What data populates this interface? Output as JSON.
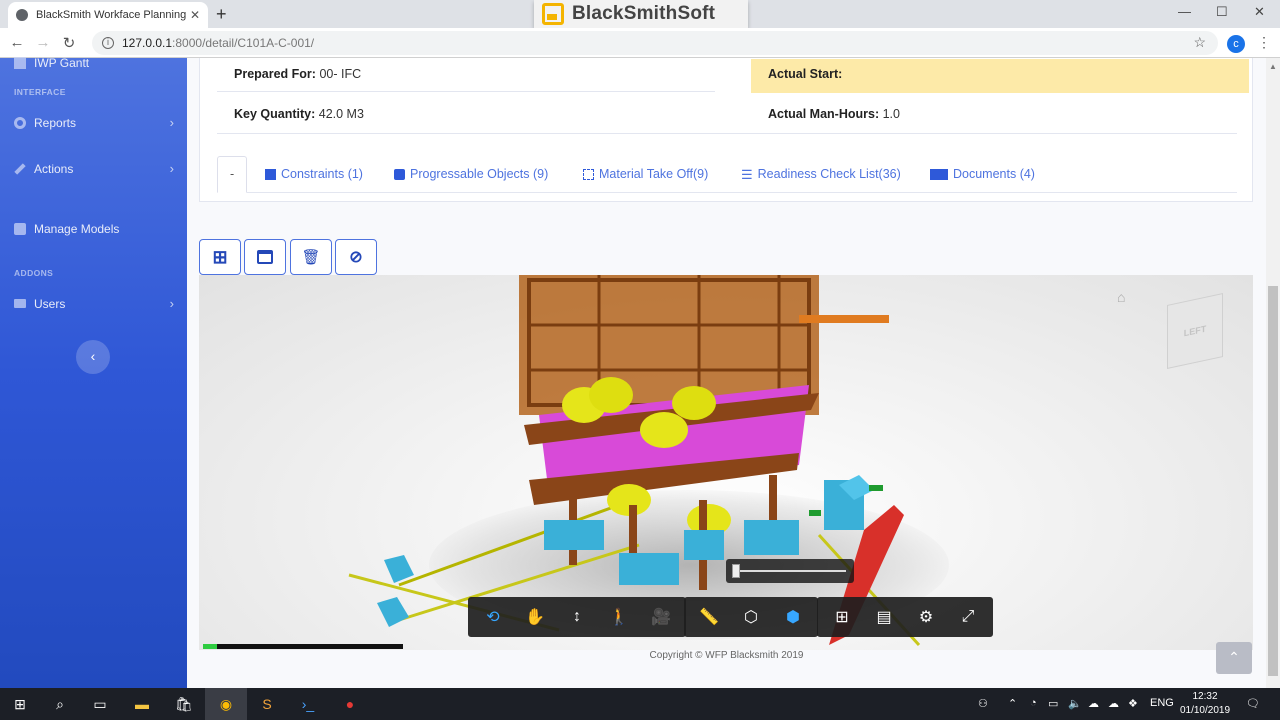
{
  "browser": {
    "tab_title": "BlackSmith Workface Planning",
    "tab_close": "✕",
    "new_tab": "+",
    "url_host": "127.0.0.1",
    "url_path": ":8000/detail/C101A-C-001/",
    "profile_initial": "c",
    "minimize": "—",
    "maximize": "☐",
    "close": "✕"
  },
  "brand": {
    "name": "BlackSmithSoft",
    "accent": "#f4b400"
  },
  "sidebar": {
    "partial_item": "IWP Gantt",
    "heading_interface": "INTERFACE",
    "heading_addons": "ADDONS",
    "items": [
      {
        "label": "Reports",
        "icon": "gear-icon"
      },
      {
        "label": "Actions",
        "icon": "wrench-icon"
      },
      {
        "label": "Manage Models",
        "icon": "cubes-icon"
      },
      {
        "label": "Users",
        "icon": "folder-icon"
      }
    ],
    "collapse_glyph": "‹",
    "gradient_top": "#4e73df",
    "gradient_bottom": "#224abe"
  },
  "details": {
    "prepared_for_label": "Prepared For:",
    "prepared_for_value": "00- IFC",
    "actual_start_label": "Actual Start:",
    "key_quantity_label": "Key Quantity:",
    "key_quantity_value": "42.0 M3",
    "actual_manhours_label": "Actual Man-Hours:",
    "actual_manhours_value": "1.0",
    "highlight_color": "#fdeaa8"
  },
  "tabs": [
    {
      "label": "-"
    },
    {
      "label": "Constraints (1)"
    },
    {
      "label": "Progressable Objects (9)"
    },
    {
      "label": "Material Take Off(9)"
    },
    {
      "label": "Readiness Check List(36)"
    },
    {
      "label": "Documents (4)"
    }
  ],
  "viewer": {
    "viewcube_label": "LEFT",
    "home_glyph": "⌂",
    "load_progress_percent": 7,
    "tools_nav": [
      "⟲",
      "✋",
      "↕",
      "🚶",
      "🎥"
    ],
    "tools_model": [
      "📏",
      "⬡",
      "⬢"
    ],
    "tools_settings": [
      "⊞",
      "▤",
      "⚙",
      "⤢"
    ]
  },
  "footer": {
    "copyright": "Copyright © WFP Blacksmith 2019",
    "to_top": "⌃"
  },
  "taskbar": {
    "language": "ENG",
    "time": "12:32",
    "date": "01/10/2019"
  }
}
